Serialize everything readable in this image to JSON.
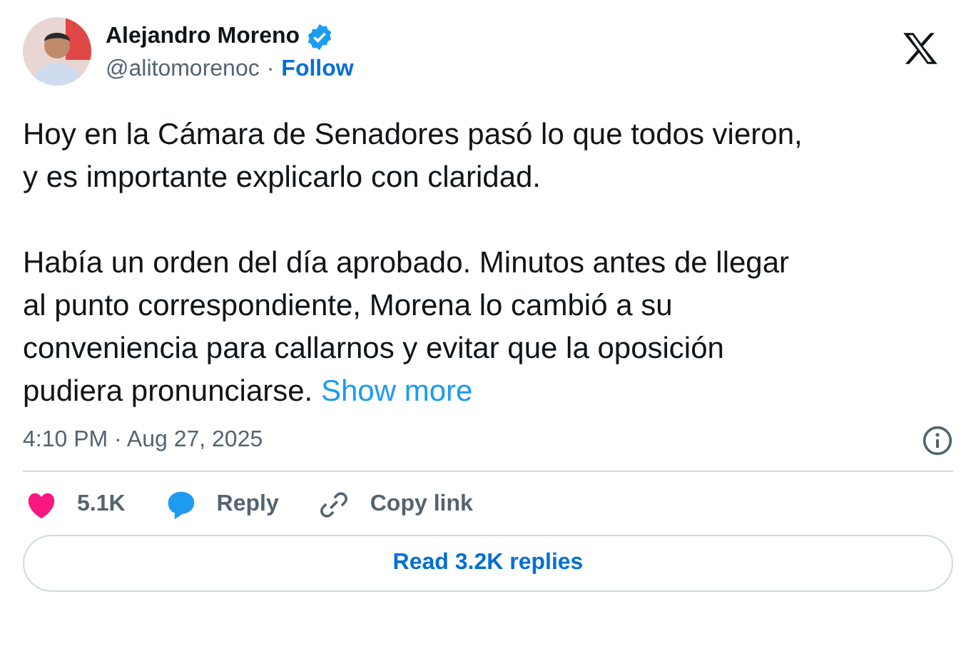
{
  "author": {
    "name": "Alejandro Moreno",
    "verified": true,
    "handle": "@alitomorenoc",
    "separator": "·",
    "follow": "Follow"
  },
  "body": {
    "paragraphs": [
      "Hoy en la Cámara de Senadores pasó lo que todos vieron,\ny es importante explicarlo con claridad.",
      "Había un orden del día aprobado. Minutos antes de llegar\nal punto correspondiente, Morena lo cambió a su\nconveniencia para callarnos y evitar que la oposición\npudiera pronunciarse."
    ],
    "show_more": "Show more"
  },
  "timestamp": "4:10 PM · Aug 27, 2025",
  "actions": [
    {
      "kind": "like",
      "label": "5.1K"
    },
    {
      "kind": "reply",
      "label": "Reply"
    },
    {
      "kind": "copy",
      "label": "Copy link"
    }
  ],
  "read_replies": "Read 3.2K replies"
}
